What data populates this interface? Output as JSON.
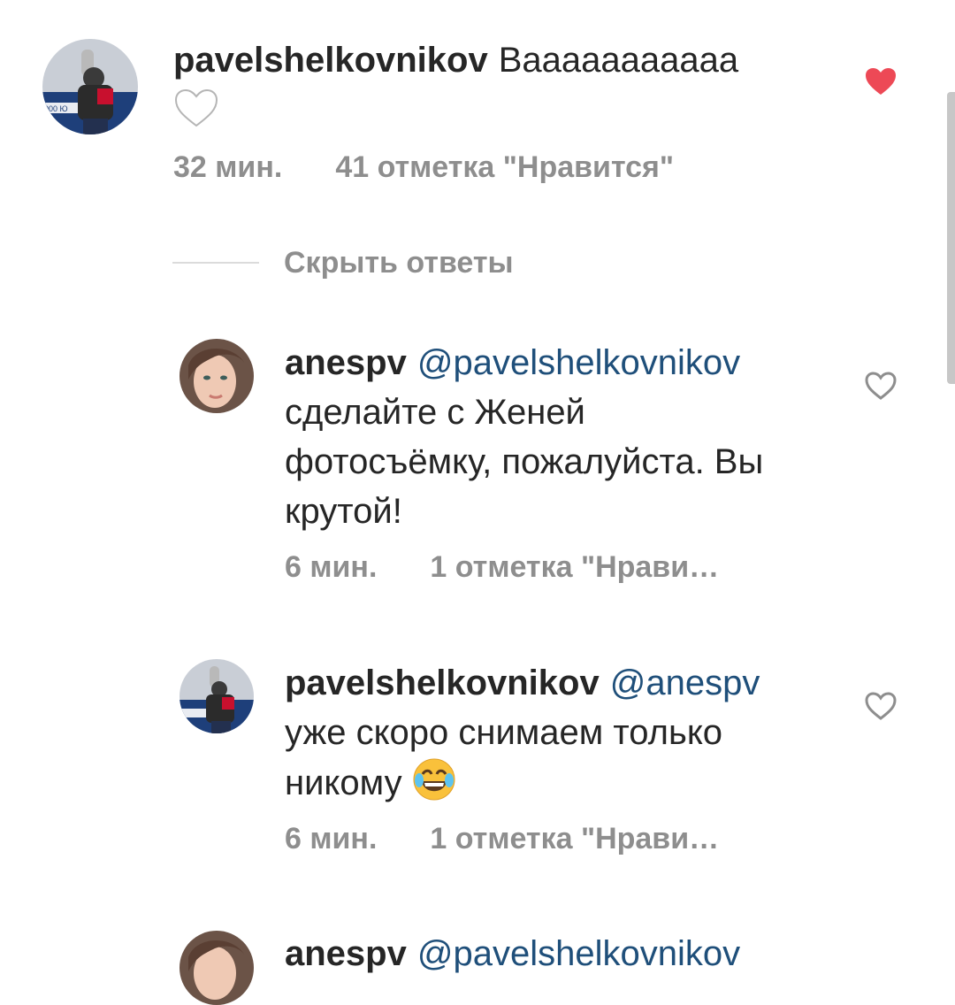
{
  "comments": [
    {
      "username": "pavelshelkovnikov",
      "mention": "",
      "text": "Вааааааааааа",
      "emoji": "white-heart",
      "time": "32 мин.",
      "likes": "41 отметка \"Нравится\"",
      "liked": true
    },
    {
      "username": "anespv",
      "mention": "@pavelshelkovnikov",
      "text": "сделайте с Женей фотосъёмку, пожалуйста. Вы крутой!",
      "time": "6 мин.",
      "likes": "1 отметка \"Нрави…",
      "liked": false
    },
    {
      "username": "pavelshelkovnikov",
      "mention": "@anespv",
      "text": "уже скоро снимаем только никому",
      "emoji": "face-with-tears-of-joy",
      "time": "6 мин.",
      "likes": "1 отметка \"Нрави…",
      "liked": false
    },
    {
      "username": "anespv",
      "mention": "@pavelshelkovnikov",
      "text": "",
      "time": "",
      "likes": "",
      "liked": false
    }
  ],
  "hide_replies_label": "Скрыть ответы",
  "colors": {
    "liked_heart": "#ed4956",
    "mention": "#1f4f7a",
    "meta": "#8e8e8e"
  }
}
